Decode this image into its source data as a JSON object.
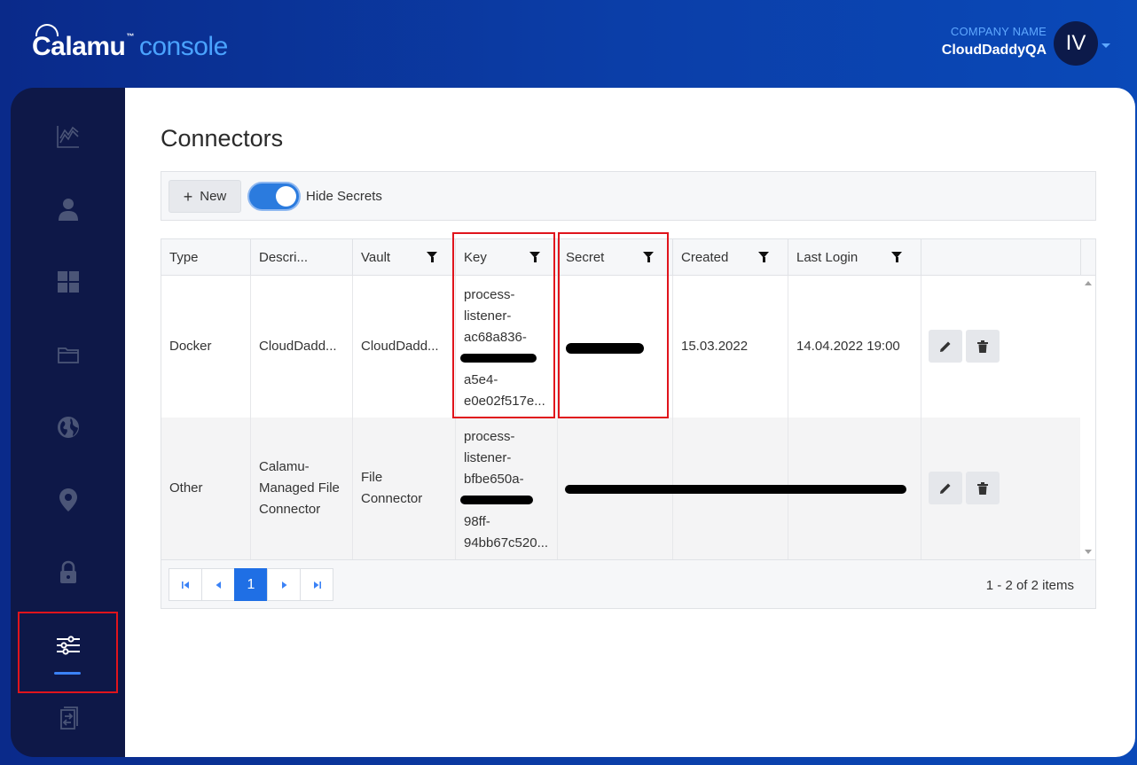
{
  "header": {
    "brand": "Calamu",
    "brand_suffix": "console",
    "company_label": "COMPANY NAME",
    "company_name": "CloudDaddyQA",
    "avatar_initials": "IV"
  },
  "sidebar": {
    "items": [
      {
        "icon": "chart-line-icon"
      },
      {
        "icon": "user-icon"
      },
      {
        "icon": "dashboard-grid-icon"
      },
      {
        "icon": "folder-icon"
      },
      {
        "icon": "globe-icon"
      },
      {
        "icon": "location-pin-icon"
      },
      {
        "icon": "lock-icon"
      },
      {
        "icon": "sliders-icon",
        "active": true
      },
      {
        "icon": "document-transfer-icon"
      }
    ],
    "accent_color": "#3b82f6"
  },
  "main": {
    "title": "Connectors",
    "toolbar": {
      "new_label": "New",
      "hide_secrets_label": "Hide Secrets",
      "hide_secrets_on": true
    },
    "table": {
      "columns": [
        "Type",
        "Descri...",
        "Vault",
        "Key",
        "Secret",
        "Created",
        "Last Login"
      ],
      "rows": [
        {
          "type": "Docker",
          "description": "CloudDadd...",
          "vault": "CloudDadd...",
          "key_lines": [
            "process-",
            "listener-",
            "ac68a836-",
            "",
            "a5e4-",
            "e0e02f517e..."
          ],
          "secret": "",
          "created": "15.03.2022",
          "last_login": "14.04.2022 19:00"
        },
        {
          "type": "Other",
          "description_lines": [
            "Calamu-",
            "Managed File",
            "Connector"
          ],
          "vault_lines": [
            "File",
            "Connector"
          ],
          "key_lines": [
            "process-",
            "listener-",
            "bfbe650a-",
            "",
            "98ff-",
            "94bb67c520..."
          ],
          "secret": "",
          "created": "",
          "last_login": ""
        }
      ]
    },
    "pager": {
      "current_page": "1",
      "info": "1 - 2 of 2 items"
    }
  }
}
